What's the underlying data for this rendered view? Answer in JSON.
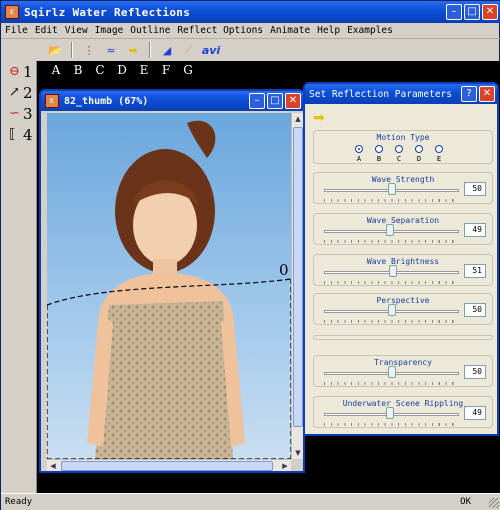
{
  "app": {
    "title": "Sqirlz Water Reflections"
  },
  "menu": [
    "File",
    "Edit",
    "View",
    "Image",
    "Outline",
    "Reflect Options",
    "Animate",
    "Help",
    "Examples"
  ],
  "toolbar": {
    "avi_label": "avi"
  },
  "left_panel": {
    "rows": [
      "1",
      "2",
      "3",
      "4"
    ]
  },
  "reflection_letters": [
    "A",
    "B",
    "C",
    "D",
    "E",
    "F",
    "G"
  ],
  "child_window": {
    "title": "82_thumb   (67%)",
    "point_label": "0"
  },
  "dialog": {
    "title": "Set Reflection Parameters",
    "motion_type": {
      "label": "Motion Type",
      "options": [
        "A",
        "B",
        "C",
        "D",
        "E"
      ],
      "selected": "A"
    },
    "sliders": [
      {
        "label": "Wave Strength",
        "value": "50",
        "level": 0.5
      },
      {
        "label": "Wave Separation",
        "value": "49",
        "level": 0.49
      },
      {
        "label": "Wave Brightness",
        "value": "51",
        "level": 0.51
      },
      {
        "label": "Perspective",
        "value": "50",
        "level": 0.5
      },
      {
        "label": "Transparency",
        "value": "50",
        "level": 0.5
      },
      {
        "label": "Underwater Scene Rippling",
        "value": "49",
        "level": 0.49
      }
    ]
  },
  "status": {
    "left": "Ready",
    "right": "OK"
  },
  "colors": {
    "titlebar": "#0c4fd8",
    "accent_red": "#d8432a",
    "label_blue": "#1a3ca8"
  }
}
